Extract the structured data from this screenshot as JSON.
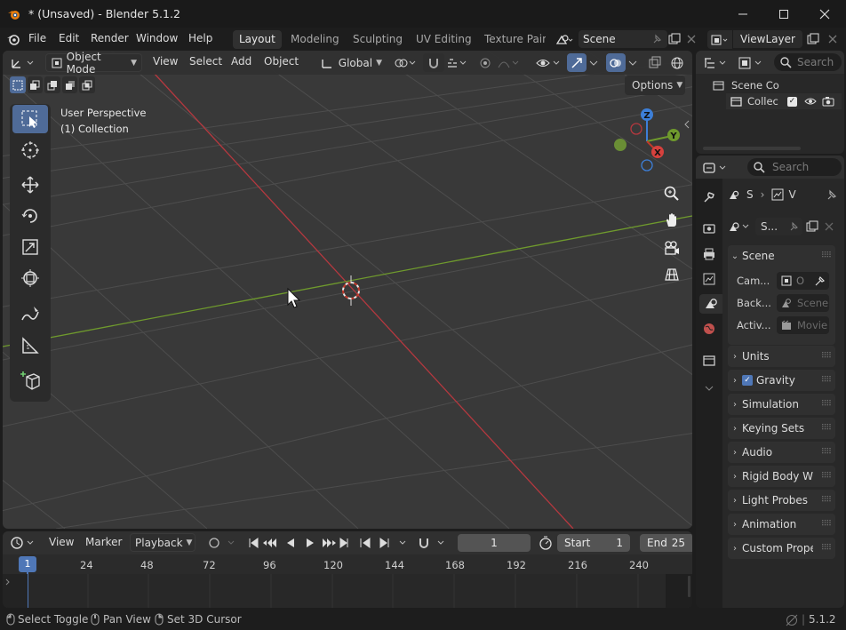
{
  "window": {
    "title": "* (Unsaved) - Blender 5.1.2",
    "controls": [
      "minimize-icon",
      "maximize-icon",
      "close-icon"
    ]
  },
  "menubar": {
    "menus": [
      "File",
      "Edit",
      "Render",
      "Window",
      "Help"
    ],
    "workspaces": [
      "Layout",
      "Modeling",
      "Sculpting",
      "UV Editing",
      "Texture Pain"
    ],
    "active_workspace": "Layout",
    "scene_name": "Scene",
    "view_layer": "ViewLayer"
  },
  "viewport": {
    "mode": "Object Mode",
    "menus": [
      "View",
      "Select",
      "Add",
      "Object"
    ],
    "transform_orientation": "Global",
    "options_label": "Options",
    "overlay_title": "User Perspective",
    "overlay_collection": "(1) Collection",
    "gizmo_axes": {
      "x": "X",
      "y": "Y",
      "z": "Z"
    },
    "colors": {
      "x_axis": "#b5383f",
      "y_axis": "#6f9a2d",
      "bg": "#393939",
      "grid": "#4a4a4a",
      "select_active": "#4f6b98"
    },
    "tools": [
      "select-box-icon",
      "cursor-icon",
      "move-icon",
      "rotate-icon",
      "scale-icon",
      "transform-icon",
      "annotate-icon",
      "measure-icon",
      "add-cube-icon"
    ]
  },
  "outliner": {
    "search_placeholder": "Search",
    "scene_collection": "Scene Co",
    "collection": "Collec"
  },
  "properties": {
    "search_placeholder": "Search",
    "breadcrumb_scene": "S",
    "breadcrumb_viewlayer": "V",
    "datablock_name": "S...",
    "scene_panel": "Scene",
    "fields": [
      {
        "label": "Cam...",
        "value": "O"
      },
      {
        "label": "Back...",
        "value": "Scene"
      },
      {
        "label": "Activ...",
        "value": "Movie"
      }
    ],
    "panels": [
      "Units",
      "Gravity",
      "Simulation",
      "Keying Sets",
      "Audio",
      "Rigid Body Wo",
      "Light Probes",
      "Animation",
      "Custom Proper"
    ],
    "gravity_checked": true
  },
  "timeline": {
    "menus": [
      "View",
      "Marker",
      "Playback"
    ],
    "current_frame": "1",
    "start_label": "Start",
    "start_value": "1",
    "end_label": "End",
    "end_value": "25",
    "playhead": "1",
    "ticks": [
      "24",
      "48",
      "72",
      "96",
      "120",
      "144",
      "168",
      "192",
      "216",
      "240"
    ]
  },
  "statusbar": {
    "hints": [
      "Select Toggle",
      "Pan View",
      "Set 3D Cursor"
    ],
    "version": "5.1.2"
  }
}
